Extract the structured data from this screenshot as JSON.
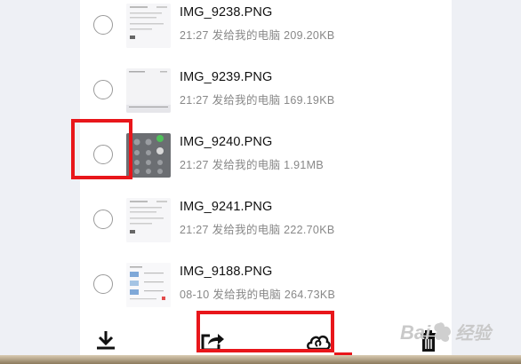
{
  "files": [
    {
      "name": "IMG_9238.PNG",
      "time": "21:27",
      "target": "发给我的电脑",
      "size": "209.20KB"
    },
    {
      "name": "IMG_9239.PNG",
      "time": "21:27",
      "target": "发给我的电脑",
      "size": "169.19KB"
    },
    {
      "name": "IMG_9240.PNG",
      "time": "21:27",
      "target": "发给我的电脑",
      "size": "1.91MB"
    },
    {
      "name": "IMG_9241.PNG",
      "time": "21:27",
      "target": "发给我的电脑",
      "size": "222.70KB"
    },
    {
      "name": "IMG_9188.PNG",
      "time": "08-10",
      "target": "发给我的电脑",
      "size": "264.73KB"
    }
  ],
  "toolbar": {
    "download_icon": "download-icon",
    "share_icon": "share-icon",
    "cloud_icon": "cloud-icon",
    "delete_icon": "trash-icon"
  },
  "watermark": {
    "text": "Bai 经验"
  },
  "colors": {
    "highlight": "#e8161b",
    "meta_text": "#888888",
    "panel": "#ffffff"
  }
}
